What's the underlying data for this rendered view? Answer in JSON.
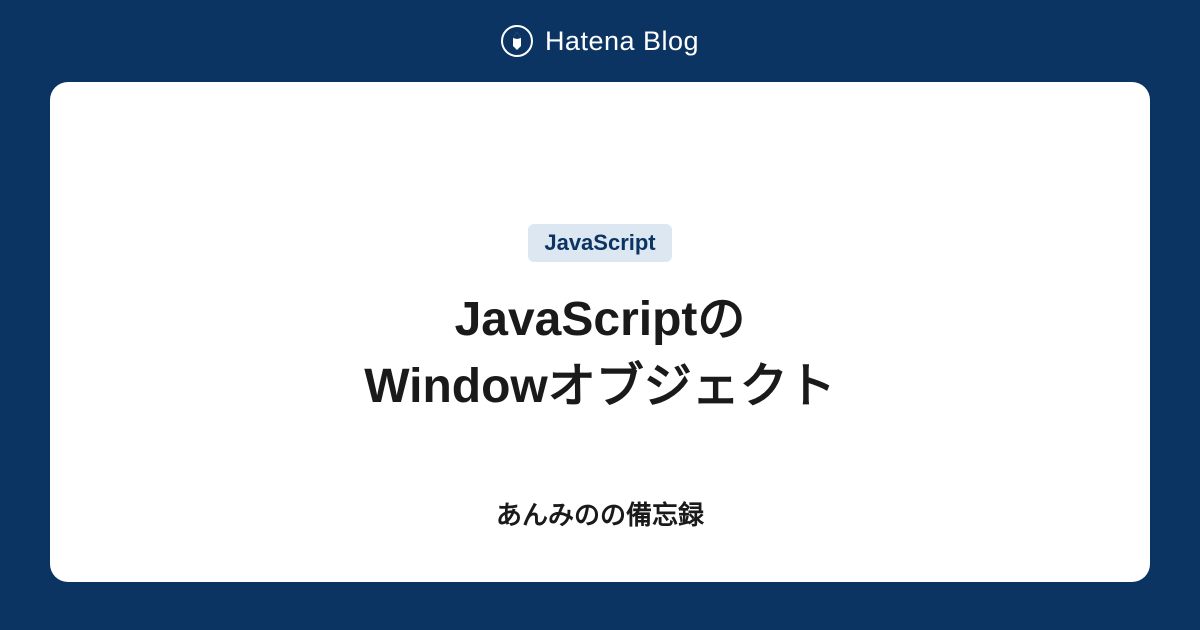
{
  "header": {
    "brand_name": "Hatena Blog"
  },
  "card": {
    "category": "JavaScript",
    "title_line1": "JavaScriptの",
    "title_line2": "Windowオブジェクト",
    "blog_name": "あんみのの備忘録"
  },
  "colors": {
    "background": "#0b3463",
    "card_bg": "#ffffff",
    "tag_bg": "#dce7f2",
    "tag_text": "#0b3463"
  }
}
